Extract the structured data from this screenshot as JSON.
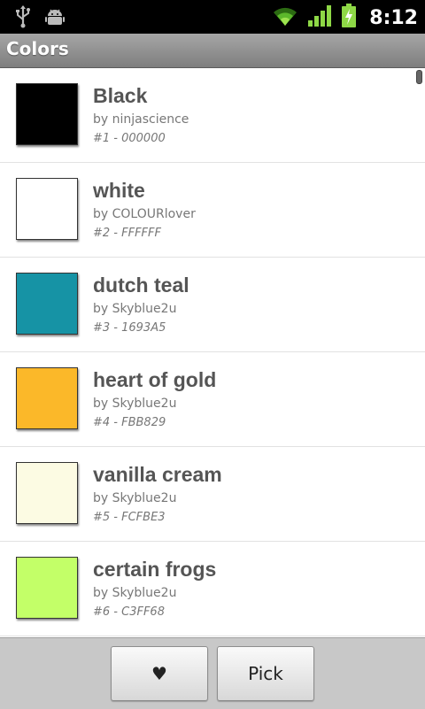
{
  "status_bar": {
    "time": "8:12",
    "icons": [
      "usb-icon",
      "android-debug-icon",
      "wifi-icon",
      "signal-icon",
      "battery-charging-icon"
    ]
  },
  "app": {
    "title": "Colors"
  },
  "colors": [
    {
      "name": "Black",
      "by": "by ninjascience",
      "meta": "#1 - 000000",
      "hex": "#000000"
    },
    {
      "name": "white",
      "by": "by COLOURlover",
      "meta": "#2 - FFFFFF",
      "hex": "#FFFFFF"
    },
    {
      "name": "dutch teal",
      "by": "by Skyblue2u",
      "meta": "#3 - 1693A5",
      "hex": "#1693A5"
    },
    {
      "name": "heart of gold",
      "by": "by Skyblue2u",
      "meta": "#4 - FBB829",
      "hex": "#FBB829"
    },
    {
      "name": "vanilla cream",
      "by": "by Skyblue2u",
      "meta": "#5 - FCFBE3",
      "hex": "#FCFBE3"
    },
    {
      "name": "certain frogs",
      "by": "by Skyblue2u",
      "meta": "#6 - C3FF68",
      "hex": "#C3FF68"
    }
  ],
  "bottom_bar": {
    "favorite_icon": "heart-icon",
    "favorite_glyph": "♥",
    "pick_label": "Pick"
  }
}
